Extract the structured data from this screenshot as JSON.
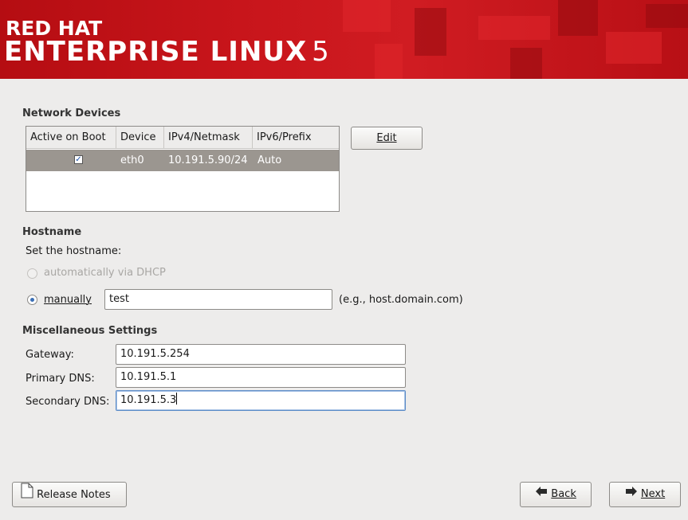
{
  "banner": {
    "line1": "RED HAT",
    "line2": "ENTERPRISE LINUX",
    "version": "5"
  },
  "network_devices": {
    "title": "Network Devices",
    "columns": [
      "Active on Boot",
      "Device",
      "IPv4/Netmask",
      "IPv6/Prefix"
    ],
    "rows": [
      {
        "active": true,
        "device": "eth0",
        "ipv4": "10.191.5.90/24",
        "ipv6": "Auto"
      }
    ],
    "edit_label": "Edit"
  },
  "hostname": {
    "title": "Hostname",
    "prompt": "Set the hostname:",
    "dhcp_label": "automatically via DHCP",
    "manual_label": "manually",
    "manual_value": "test",
    "example": "(e.g., host.domain.com)",
    "selected": "manually"
  },
  "misc": {
    "title": "Miscellaneous Settings",
    "gateway_label": "Gateway:",
    "gateway_value": "10.191.5.254",
    "primary_dns_label": "Primary DNS:",
    "primary_dns_value": "10.191.5.1",
    "secondary_dns_label": "Secondary DNS:",
    "secondary_dns_value": "10.191.5.3"
  },
  "footer": {
    "release_notes_label": "Release Notes",
    "back_label": "Back",
    "next_label": "Next"
  },
  "icons": {
    "release_notes": "document-icon",
    "back": "arrow-left-icon",
    "next": "arrow-right-icon"
  },
  "colors": {
    "banner_red": "#c8151b",
    "selected_row": "#9b9690",
    "background": "#edeceb"
  }
}
